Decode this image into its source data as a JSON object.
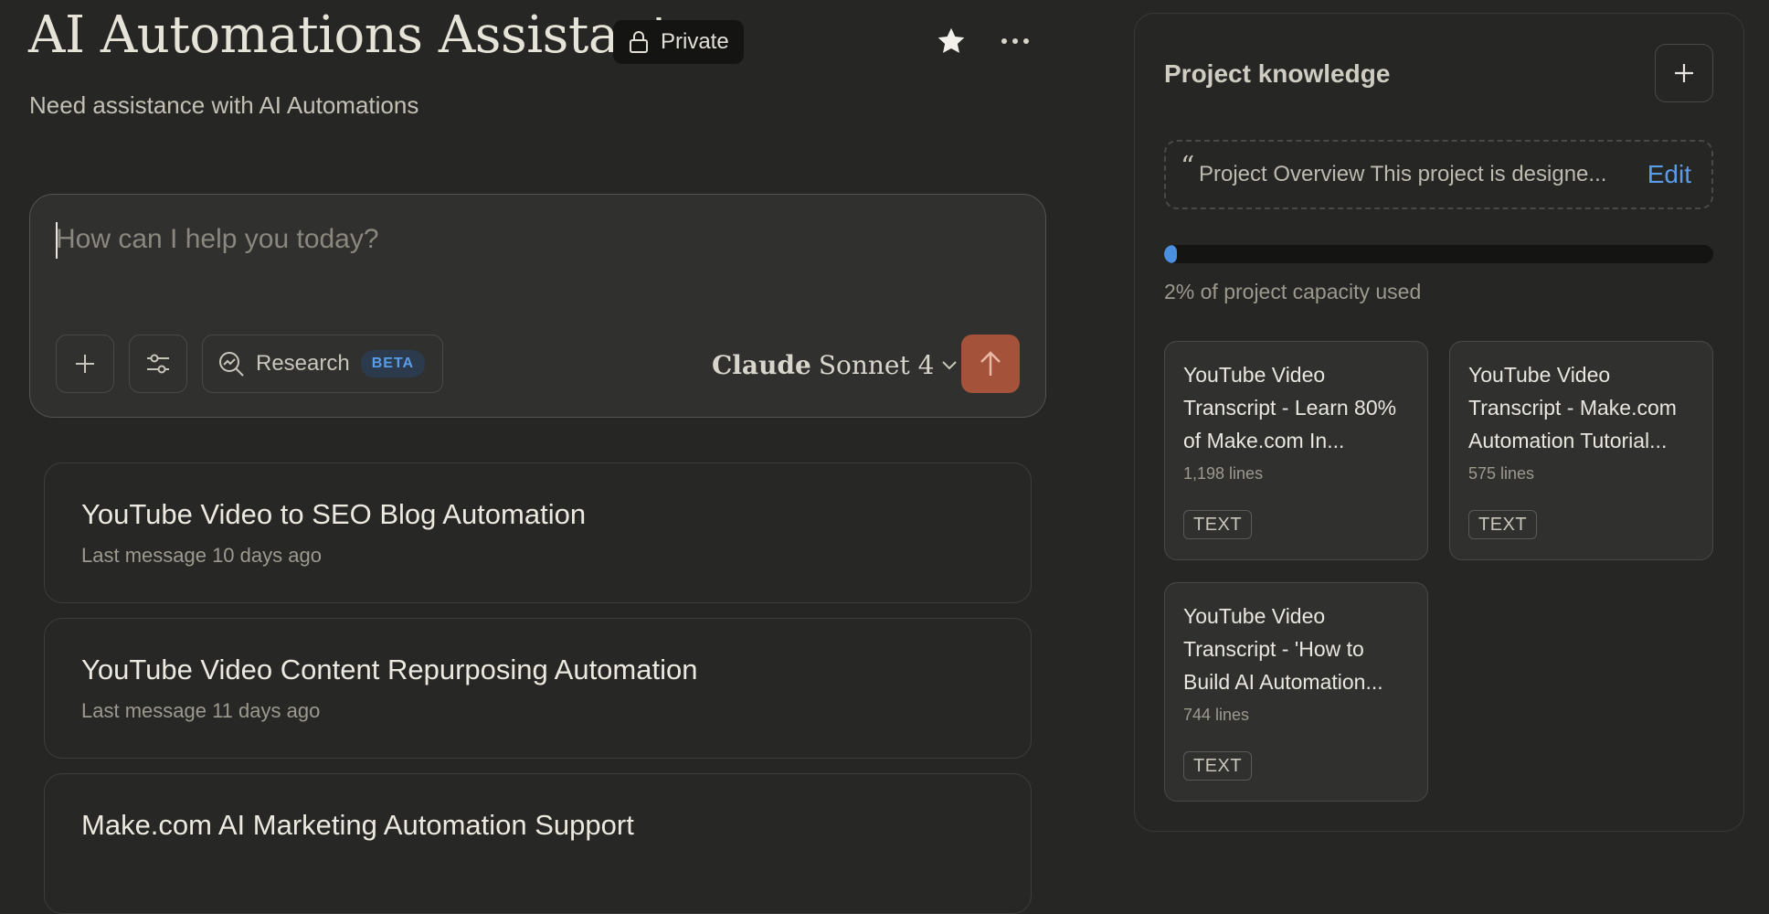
{
  "header": {
    "title": "AI Automations Assistant",
    "visibility": "Private",
    "subtitle": "Need assistance with AI Automations"
  },
  "composer": {
    "placeholder": "How can I help you today?",
    "research_label": "Research",
    "research_badge": "BETA",
    "model_brand": "Claude",
    "model_name": "Sonnet 4"
  },
  "chats": [
    {
      "title": "YouTube Video to SEO Blog Automation",
      "meta": "Last message 10 days ago"
    },
    {
      "title": "YouTube Video Content Repurposing Automation",
      "meta": "Last message 11 days ago"
    },
    {
      "title": "Make.com AI Marketing Automation Support",
      "meta": ""
    }
  ],
  "knowledge": {
    "title": "Project knowledge",
    "overview_quote": "“",
    "overview_text": "Project Overview This project is designe...",
    "edit_label": "Edit",
    "capacity_percent": 2,
    "capacity_text": "2% of project capacity used",
    "files": [
      {
        "title": "YouTube Video Transcript - Learn 80% of Make.com In...",
        "lines": "1,198 lines",
        "type": "TEXT"
      },
      {
        "title": "YouTube Video Transcript - Make.com Automation Tutorial...",
        "lines": "575 lines",
        "type": "TEXT"
      },
      {
        "title": "YouTube Video Transcript - 'How to Build AI Automation...",
        "lines": "744 lines",
        "type": "TEXT"
      }
    ]
  },
  "colors": {
    "background": "#262624",
    "accent_send": "#a5523a",
    "link_blue": "#5a9ce8"
  },
  "icons": [
    "lock-icon",
    "star-icon",
    "more-icon",
    "plus-icon",
    "sliders-icon",
    "research-icon",
    "chevron-down-icon",
    "arrow-up-icon"
  ]
}
